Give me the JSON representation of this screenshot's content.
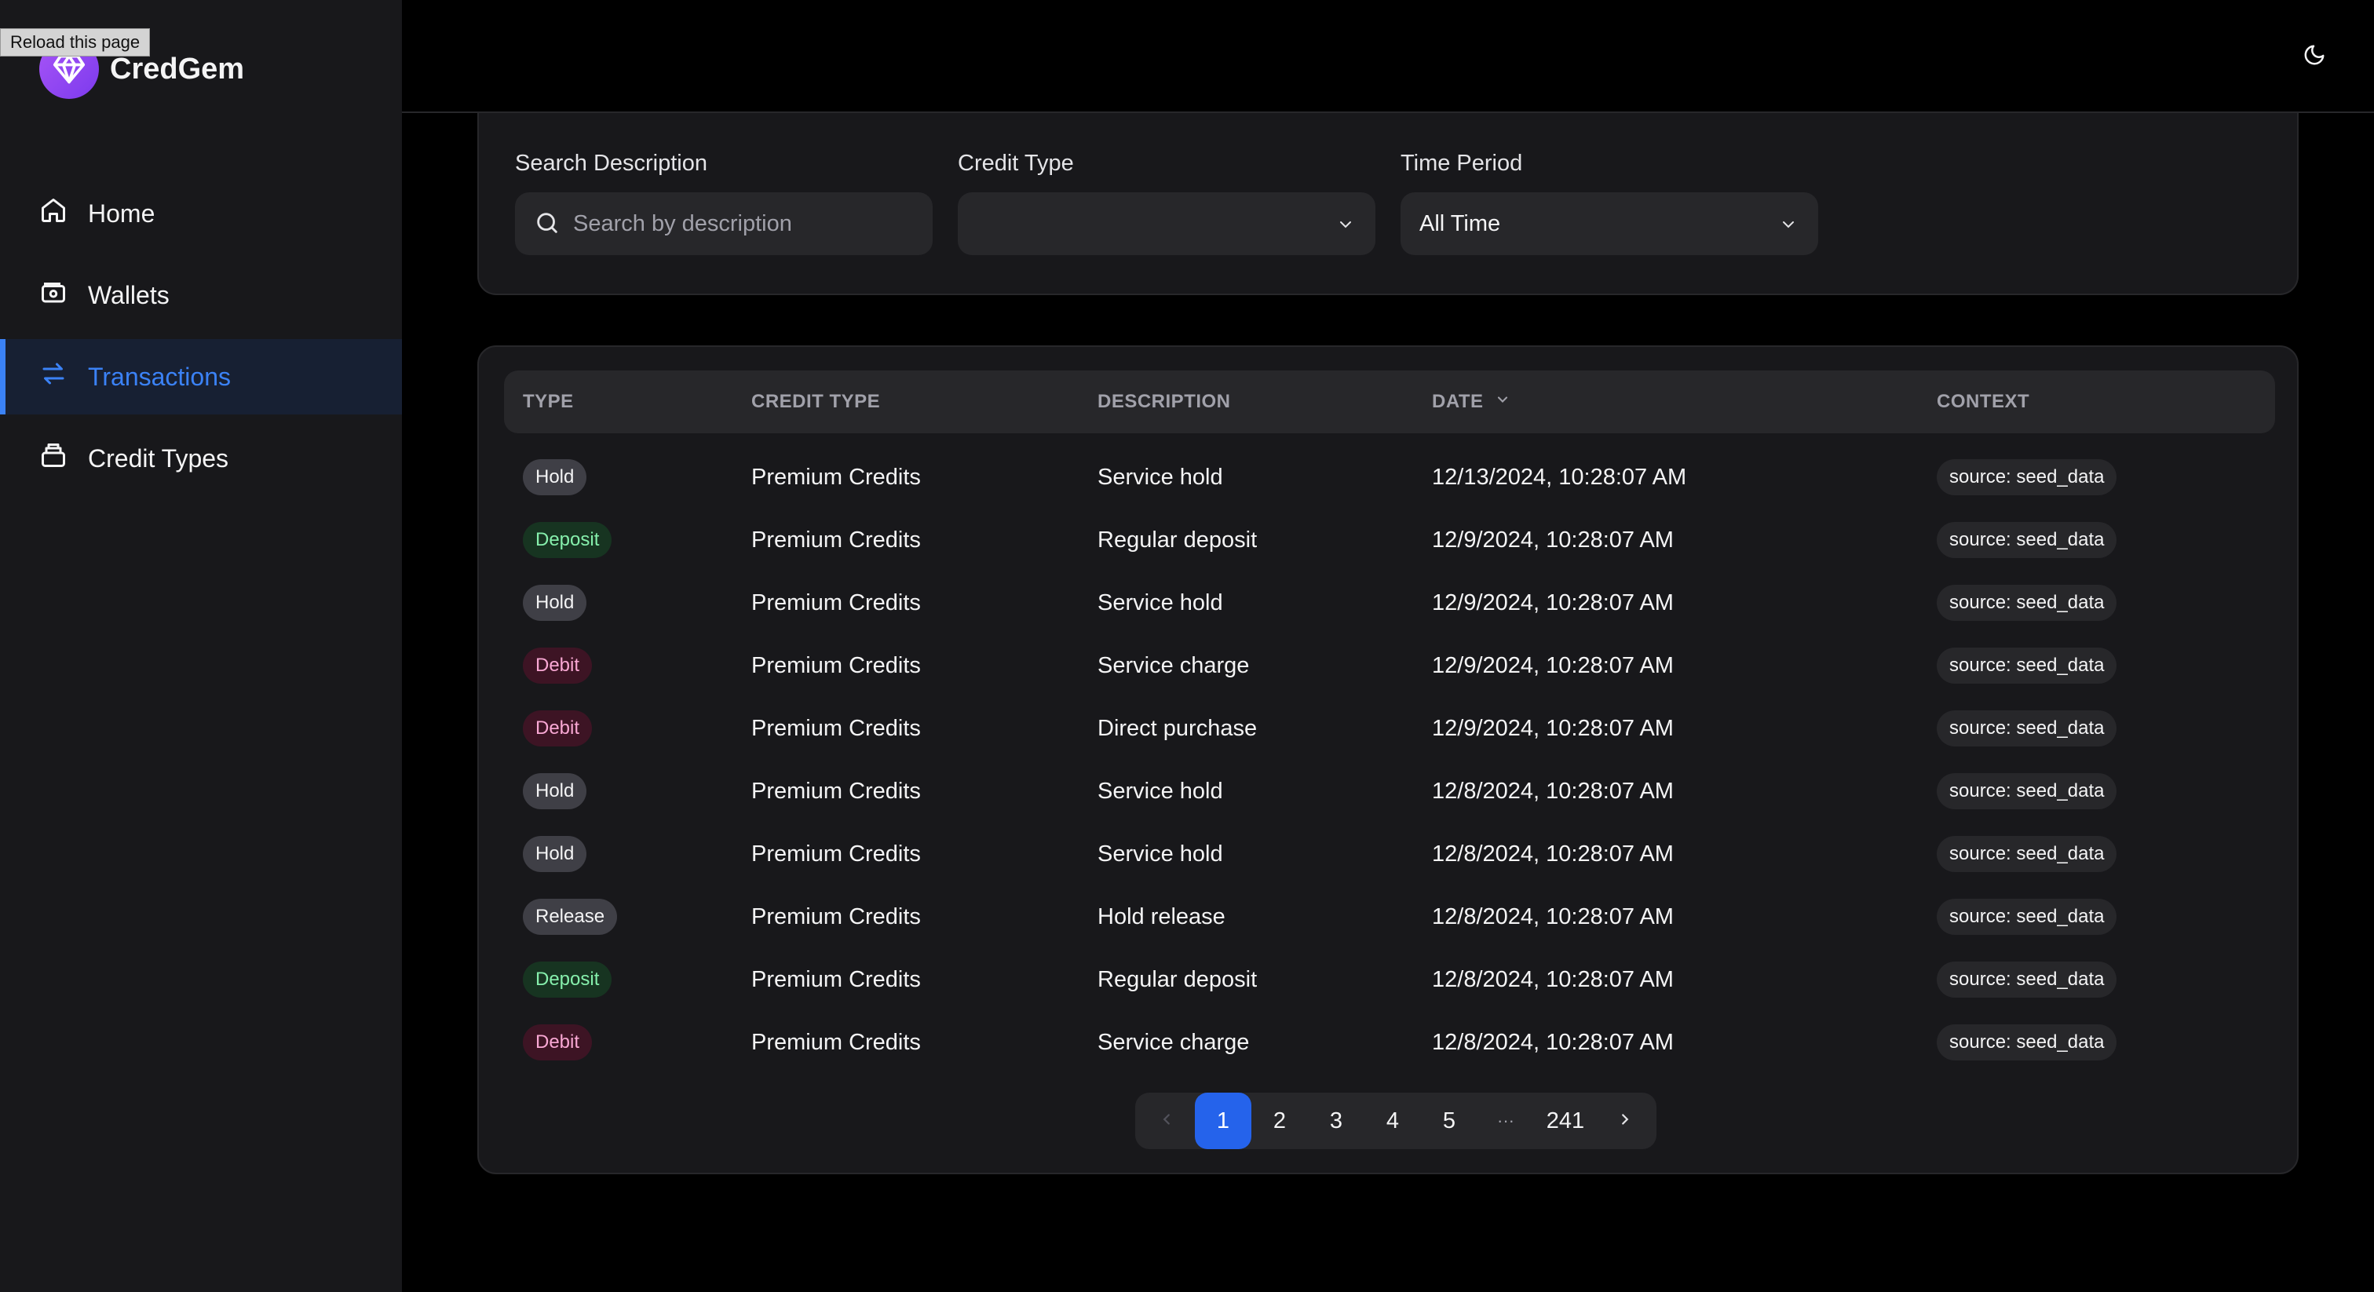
{
  "tooltip": "Reload this page",
  "brand": {
    "name": "CredGem"
  },
  "nav": [
    {
      "label": "Home",
      "icon": "home-icon"
    },
    {
      "label": "Wallets",
      "icon": "wallet-icon"
    },
    {
      "label": "Transactions",
      "icon": "arrows-exchange-icon",
      "active": true
    },
    {
      "label": "Credit Types",
      "icon": "credit-type-icon"
    }
  ],
  "filters": {
    "search": {
      "label": "Search Description",
      "placeholder": "Search by description",
      "value": ""
    },
    "credit_type": {
      "label": "Credit Type",
      "value": ""
    },
    "time_period": {
      "label": "Time Period",
      "value": "All Time"
    }
  },
  "table": {
    "headers": [
      "TYPE",
      "CREDIT TYPE",
      "DESCRIPTION",
      "DATE",
      "CONTEXT"
    ],
    "rows": [
      {
        "type": "Hold",
        "credit_type": "Premium Credits",
        "description": "Service hold",
        "date": "12/13/2024, 10:28:07 AM",
        "context": "source: seed_data"
      },
      {
        "type": "Deposit",
        "credit_type": "Premium Credits",
        "description": "Regular deposit",
        "date": "12/9/2024, 10:28:07 AM",
        "context": "source: seed_data"
      },
      {
        "type": "Hold",
        "credit_type": "Premium Credits",
        "description": "Service hold",
        "date": "12/9/2024, 10:28:07 AM",
        "context": "source: seed_data"
      },
      {
        "type": "Debit",
        "credit_type": "Premium Credits",
        "description": "Service charge",
        "date": "12/9/2024, 10:28:07 AM",
        "context": "source: seed_data"
      },
      {
        "type": "Debit",
        "credit_type": "Premium Credits",
        "description": "Direct purchase",
        "date": "12/9/2024, 10:28:07 AM",
        "context": "source: seed_data"
      },
      {
        "type": "Hold",
        "credit_type": "Premium Credits",
        "description": "Service hold",
        "date": "12/8/2024, 10:28:07 AM",
        "context": "source: seed_data"
      },
      {
        "type": "Hold",
        "credit_type": "Premium Credits",
        "description": "Service hold",
        "date": "12/8/2024, 10:28:07 AM",
        "context": "source: seed_data"
      },
      {
        "type": "Release",
        "credit_type": "Premium Credits",
        "description": "Hold release",
        "date": "12/8/2024, 10:28:07 AM",
        "context": "source: seed_data"
      },
      {
        "type": "Deposit",
        "credit_type": "Premium Credits",
        "description": "Regular deposit",
        "date": "12/8/2024, 10:28:07 AM",
        "context": "source: seed_data"
      },
      {
        "type": "Debit",
        "credit_type": "Premium Credits",
        "description": "Service charge",
        "date": "12/8/2024, 10:28:07 AM",
        "context": "source: seed_data"
      }
    ]
  },
  "pagination": {
    "pages": [
      "1",
      "2",
      "3",
      "4",
      "5"
    ],
    "ellipsis": "···",
    "last": "241",
    "current": "1"
  },
  "colors": {
    "accent": "#3b82f6",
    "deposit": "#86efac",
    "debit": "#f9a8d4"
  }
}
